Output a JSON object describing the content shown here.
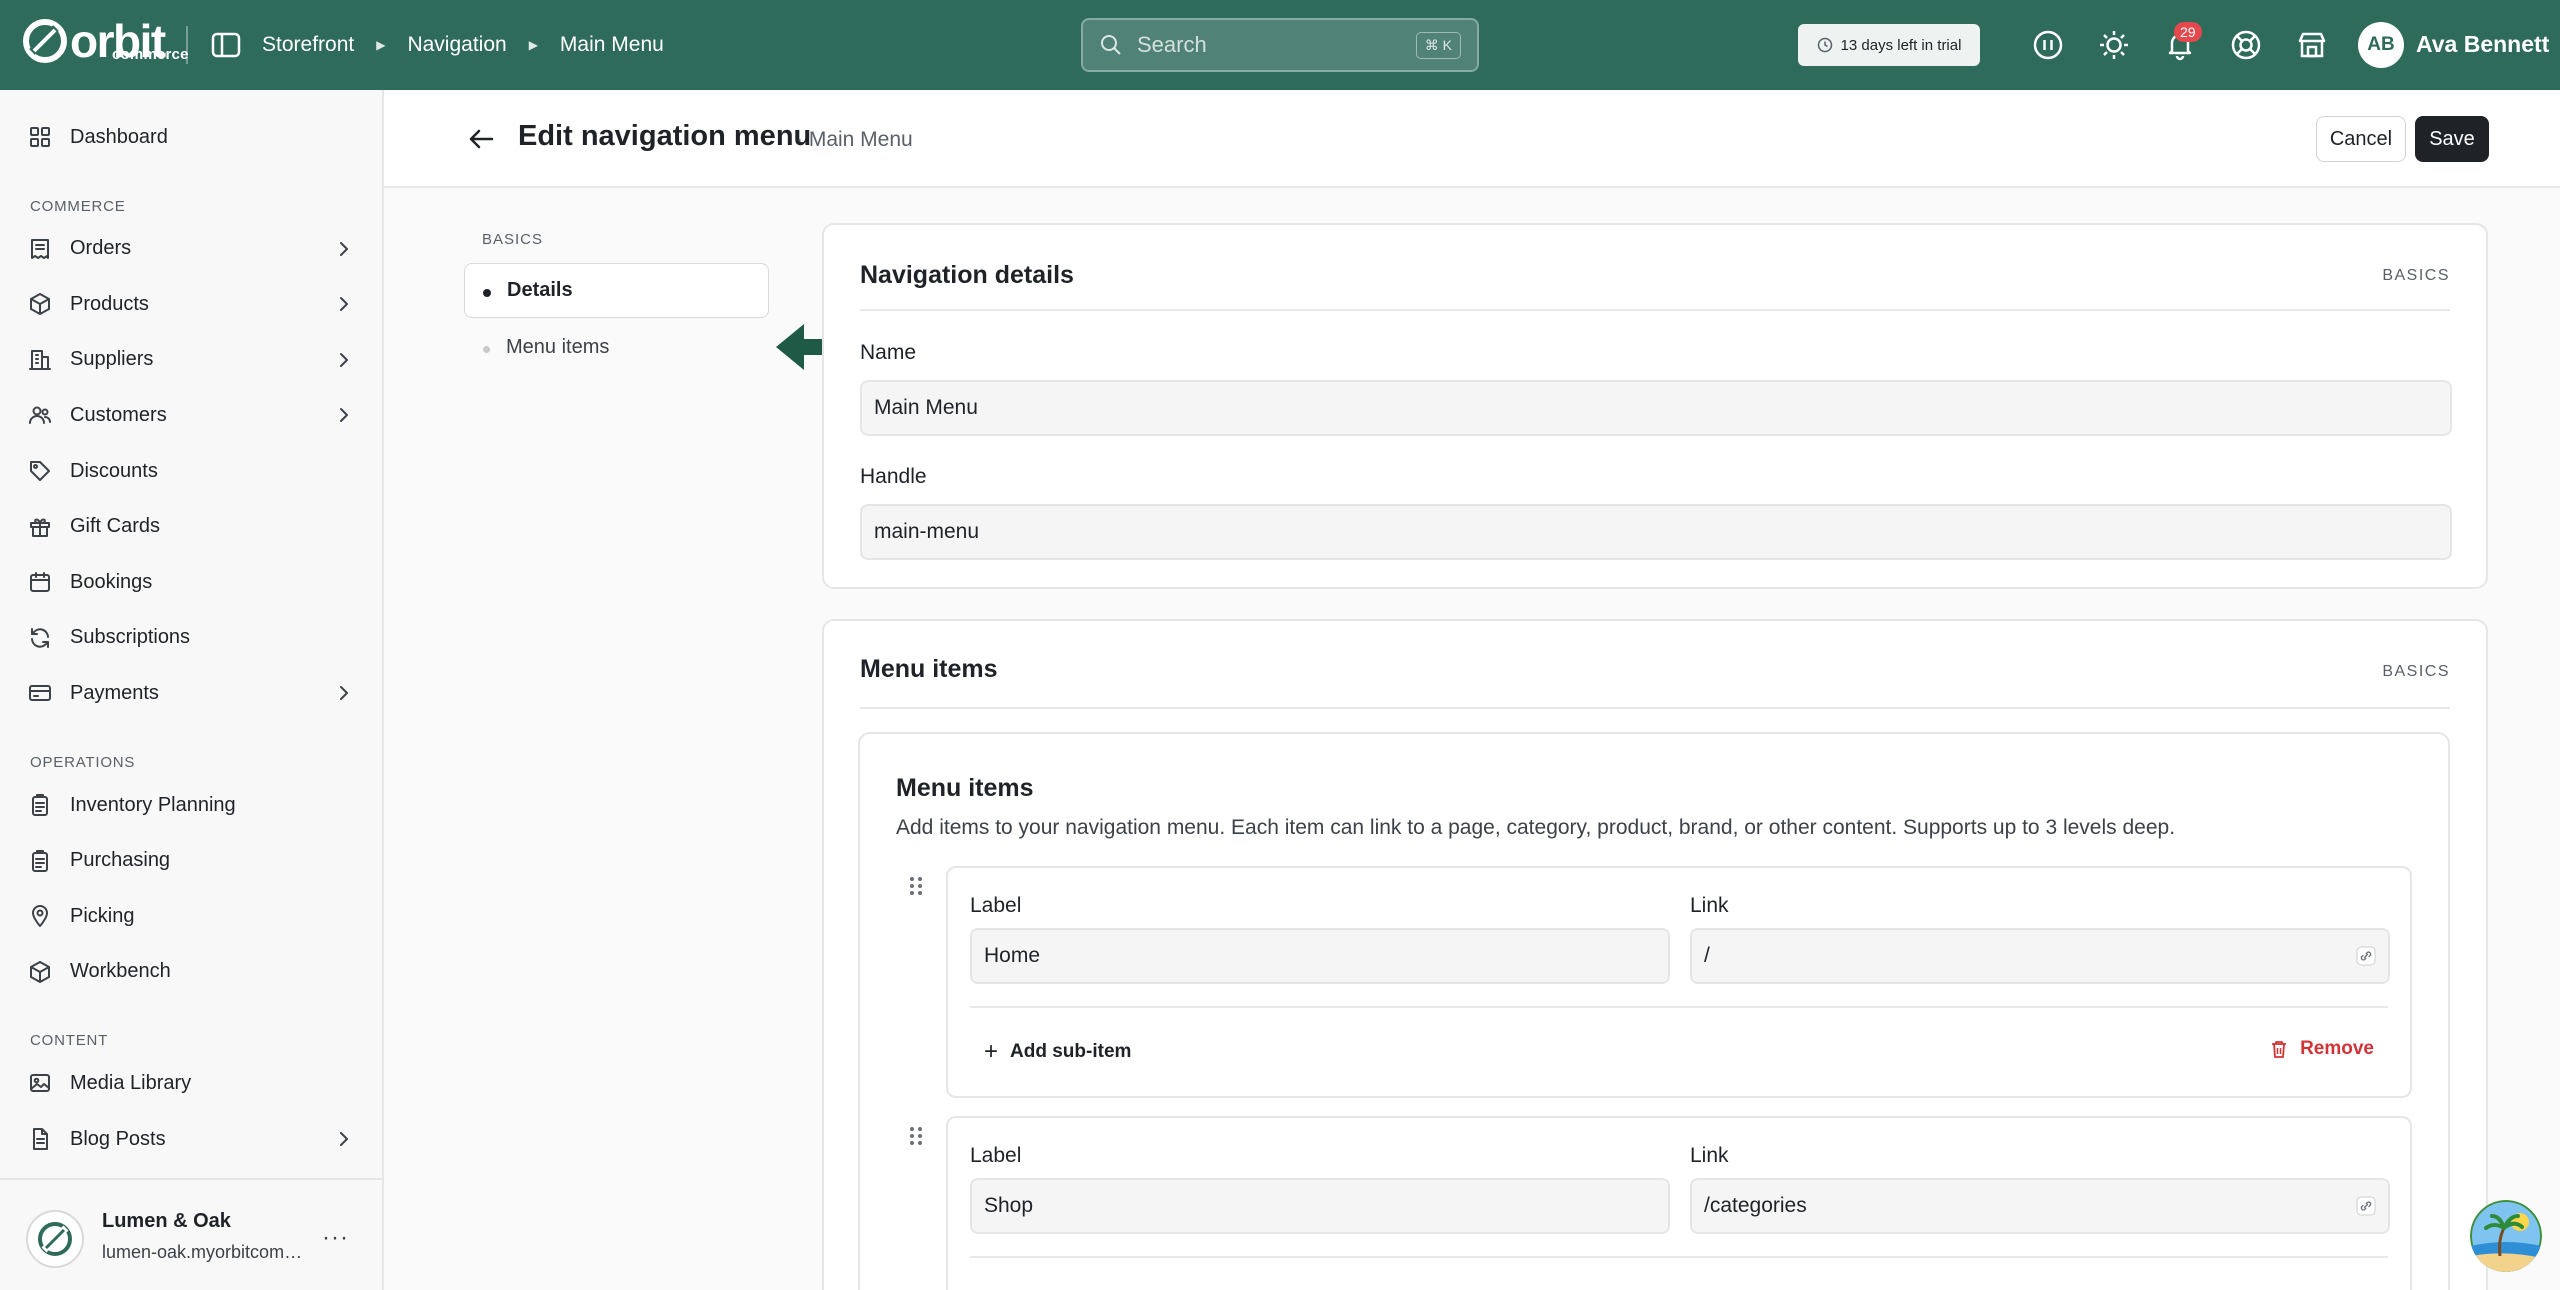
{
  "topbar": {
    "logo_text": "orbit",
    "logo_sub": "commerce",
    "breadcrumbs": [
      "Storefront",
      "Navigation",
      "Main Menu"
    ],
    "search_placeholder": "Search",
    "search_shortcut": "⌘ K",
    "trial_text": "13 days left in trial",
    "notification_count": "29",
    "user_initials": "AB",
    "user_name": "Ava Bennett"
  },
  "sidebar": {
    "top_items": [
      {
        "label": "Dashboard",
        "icon": "dashboard-icon"
      }
    ],
    "groups": [
      {
        "title": "COMMERCE",
        "items": [
          {
            "label": "Orders",
            "icon": "orders-icon",
            "chevron": true
          },
          {
            "label": "Products",
            "icon": "box-icon",
            "chevron": true
          },
          {
            "label": "Suppliers",
            "icon": "building-icon",
            "chevron": true
          },
          {
            "label": "Customers",
            "icon": "users-icon",
            "chevron": true
          },
          {
            "label": "Discounts",
            "icon": "tag-icon",
            "chevron": false
          },
          {
            "label": "Gift Cards",
            "icon": "gift-icon",
            "chevron": false
          },
          {
            "label": "Bookings",
            "icon": "calendar-icon",
            "chevron": false
          },
          {
            "label": "Subscriptions",
            "icon": "refresh-icon",
            "chevron": false
          },
          {
            "label": "Payments",
            "icon": "card-icon",
            "chevron": true
          }
        ]
      },
      {
        "title": "OPERATIONS",
        "items": [
          {
            "label": "Inventory Planning",
            "icon": "clipboard-icon",
            "chevron": false
          },
          {
            "label": "Purchasing",
            "icon": "clipboard-icon",
            "chevron": false
          },
          {
            "label": "Picking",
            "icon": "pin-icon",
            "chevron": false
          },
          {
            "label": "Workbench",
            "icon": "cube-icon",
            "chevron": false
          }
        ]
      },
      {
        "title": "CONTENT",
        "items": [
          {
            "label": "Media Library",
            "icon": "image-icon",
            "chevron": false
          },
          {
            "label": "Blog Posts",
            "icon": "file-icon",
            "chevron": true
          }
        ]
      }
    ],
    "store_name": "Lumen & Oak",
    "store_url": "lumen-oak.myorbitcommerce.com"
  },
  "page": {
    "title": "Edit navigation menu",
    "subtitle": "· Main Menu",
    "cancel_label": "Cancel",
    "save_label": "Save"
  },
  "section_nav": {
    "group_label": "BASICS",
    "items": [
      "Details",
      "Menu items"
    ]
  },
  "details_card": {
    "title": "Navigation details",
    "tag": "BASICS",
    "name_label": "Name",
    "name_value": "Main Menu",
    "handle_label": "Handle",
    "handle_value": "main-menu"
  },
  "menu_card": {
    "title": "Menu items",
    "tag": "BASICS",
    "inner_title": "Menu items",
    "inner_desc": "Add items to your navigation menu. Each item can link to a page, category, product, brand, or other content. Supports up to 3 levels deep.",
    "label_heading": "Label",
    "link_heading": "Link",
    "add_sub_label": "Add sub-item",
    "remove_label": "Remove",
    "items": [
      {
        "label": "Home",
        "link": "/"
      },
      {
        "label": "Shop",
        "link": "/categories"
      }
    ]
  },
  "colors": {
    "brand": "#2f6b5b",
    "danger": "#d13438",
    "dark": "#1f2328"
  }
}
